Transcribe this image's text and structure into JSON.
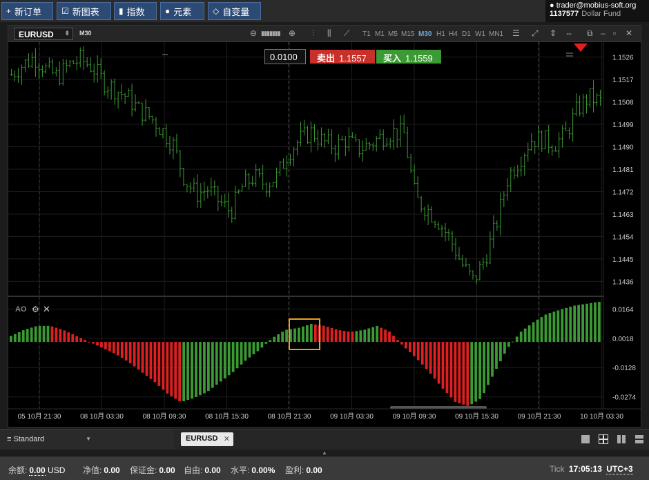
{
  "toolbar": {
    "new_order": "新订单",
    "new_chart": "新图表",
    "indicators": "指数",
    "elements": "元素",
    "custom_vars": "自变量"
  },
  "account": {
    "user": "trader@mobius-soft.org",
    "number": "1137577",
    "fund": "Dollar Fund"
  },
  "chart": {
    "symbol": "EURUSD",
    "timeframe": "M30",
    "timeframes": [
      "T1",
      "M1",
      "M5",
      "M15",
      "M30",
      "H1",
      "H4",
      "D1",
      "W1",
      "MN1"
    ],
    "active_timeframe": "M30",
    "spread": "0.0100",
    "sell_label": "卖出",
    "sell_price": "1.1557",
    "buy_label": "买入",
    "buy_price": "1.1559",
    "price_ticks": [
      "1.1526",
      "1.1517",
      "1.1508",
      "1.1499",
      "1.1490",
      "1.1481",
      "1.1472",
      "1.1463",
      "1.1454",
      "1.1445",
      "1.1436"
    ],
    "ao_label": "AO",
    "ao_ticks": [
      "0.0164",
      "0.0018",
      "-0.0128",
      "-0.0274"
    ],
    "time_ticks": [
      "05 10月 21:30",
      "08 10月 03:30",
      "08 10月 09:30",
      "08 10月 15:30",
      "08 10月 21:30",
      "09 10月 03:30",
      "09 10月 09:30",
      "09 10月 15:30",
      "09 10月 21:30",
      "10 10月 03:30"
    ],
    "colors": {
      "bull": "#3c9a34",
      "bear": "#e02020",
      "highlight": "#f0a020",
      "grid": "#1e1e1e"
    }
  },
  "chart_data": [
    {
      "type": "ohlc",
      "symbol": "EURUSD",
      "timeframe": "M30",
      "ylim": [
        1.143,
        1.1532
      ],
      "ylabel": "",
      "xlabel": "",
      "close_values": [
        1.1519,
        1.1523,
        1.1526,
        1.1521,
        1.1518,
        1.1523,
        1.1525,
        1.1522,
        1.1516,
        1.1513,
        1.151,
        1.1505,
        1.1502,
        1.1497,
        1.1491,
        1.1477,
        1.1471,
        1.1473,
        1.1468,
        1.1464,
        1.1474,
        1.1478,
        1.1475,
        1.1478,
        1.1488,
        1.1493,
        1.1496,
        1.1492,
        1.149,
        1.1493,
        1.1489,
        1.1491,
        1.1494,
        1.1496,
        1.1495,
        1.1469,
        1.1465,
        1.146,
        1.1453,
        1.1443,
        1.1436,
        1.1445,
        1.1459,
        1.1478,
        1.1485,
        1.1493,
        1.1493,
        1.1491,
        1.1495,
        1.1505,
        1.151,
        1.1508
      ]
    },
    {
      "type": "bar",
      "title": "AO",
      "ylim": [
        -0.032,
        0.02
      ],
      "values": [
        0.003,
        0.006,
        0.008,
        0.008,
        0.006,
        0.003,
        0.0,
        -0.003,
        -0.006,
        -0.01,
        -0.015,
        -0.02,
        -0.026,
        -0.03,
        -0.028,
        -0.025,
        -0.02,
        -0.015,
        -0.009,
        -0.004,
        0.002,
        0.006,
        0.007,
        0.009,
        0.008,
        0.006,
        0.005,
        0.006,
        0.008,
        0.005,
        -0.002,
        -0.008,
        -0.015,
        -0.023,
        -0.03,
        -0.032,
        -0.028,
        -0.015,
        -0.003,
        0.005,
        0.01,
        0.014,
        0.016,
        0.018,
        0.019,
        0.02
      ]
    }
  ],
  "tabs": {
    "workspace": "Standard",
    "open_tab": "EURUSD"
  },
  "status": {
    "balance_label": "余额:",
    "balance_value": "0.00",
    "balance_currency": "USD",
    "equity_label": "净值:",
    "equity_value": "0.00",
    "margin_label": "保证金:",
    "margin_value": "0.00",
    "free_label": "自由:",
    "free_value": "0.00",
    "level_label": "水平:",
    "level_value": "0.00%",
    "pl_label": "盈利:",
    "pl_value": "0.00",
    "tick_label": "Tick",
    "time": "17:05:13",
    "timezone": "UTC+3"
  }
}
